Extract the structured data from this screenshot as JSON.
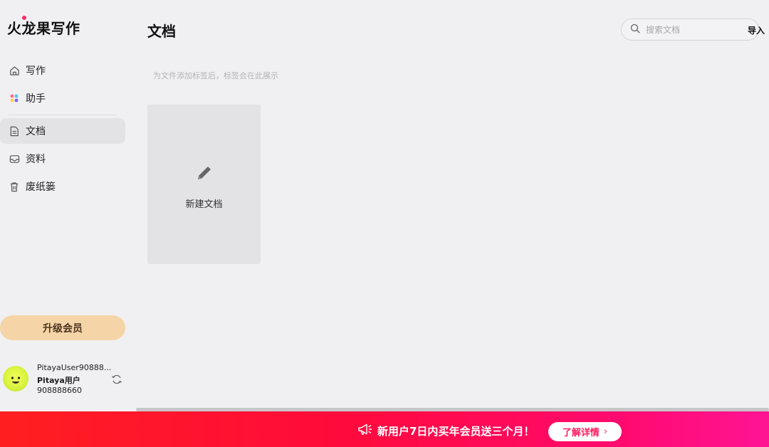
{
  "app": {
    "logo_text": "火龙果写作"
  },
  "sidebar": {
    "items": [
      {
        "label": "写作",
        "icon": "home-icon"
      },
      {
        "label": "助手",
        "icon": "assistant-icon"
      },
      {
        "label": "文档",
        "icon": "document-icon",
        "active": true
      },
      {
        "label": "资料",
        "icon": "inbox-icon"
      },
      {
        "label": "废纸篓",
        "icon": "trash-icon"
      }
    ],
    "upgrade_label": "升级会员",
    "user": {
      "name": "PitayaUser90888...",
      "nickname": "Pitaya用户",
      "id": "908888660"
    }
  },
  "main": {
    "title": "文档",
    "search": {
      "placeholder": "搜索文档",
      "value": ""
    },
    "import_label": "导入",
    "tag_hint": "为文件添加标签后，标签会在此展示",
    "new_doc_label": "新建文档"
  },
  "promo": {
    "text": "新用户7日内买年会员送三个月！",
    "button_label": "了解详情",
    "button_chevron": "›"
  },
  "colors": {
    "background": "#f0f0f2",
    "upgrade_button": "#f5d4a7",
    "promo_start": "#ff1f1f",
    "promo_end": "#ff1493",
    "active_nav": "#e3e3e6"
  }
}
